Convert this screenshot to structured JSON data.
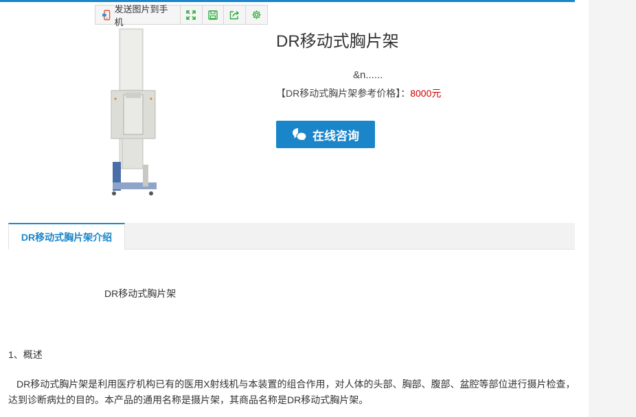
{
  "toolbar": {
    "send_label": "发送图片到手机",
    "icons": [
      "fullscreen-icon",
      "save-icon",
      "share-icon",
      "settings-icon"
    ]
  },
  "product": {
    "title": "DR移动式胸片架",
    "ellipsis": "&n......",
    "price_label": "【DR移动式胸片架参考价格】：",
    "price_value": "8000元",
    "consult_label": "在线咨询"
  },
  "tabs": [
    {
      "label": "DR移动式胸片架介绍",
      "active": true
    }
  ],
  "content": {
    "intro_name": "DR移动式胸片架",
    "section_heading": "1、概述",
    "paragraph": "DR移动式胸片架是利用医疗机构已有的医用X射线机与本装置的组合作用，对人体的头部、胸部、腹部、盆腔等部位进行摄片检查，达到诊断病灶的目的。本产品的通用名称是摄片架，其商品名称是DR移动式胸片架。"
  },
  "colors": {
    "accent": "#1a86c9",
    "price": "#cc0000",
    "toolbar_icon": "#2bab3c"
  }
}
